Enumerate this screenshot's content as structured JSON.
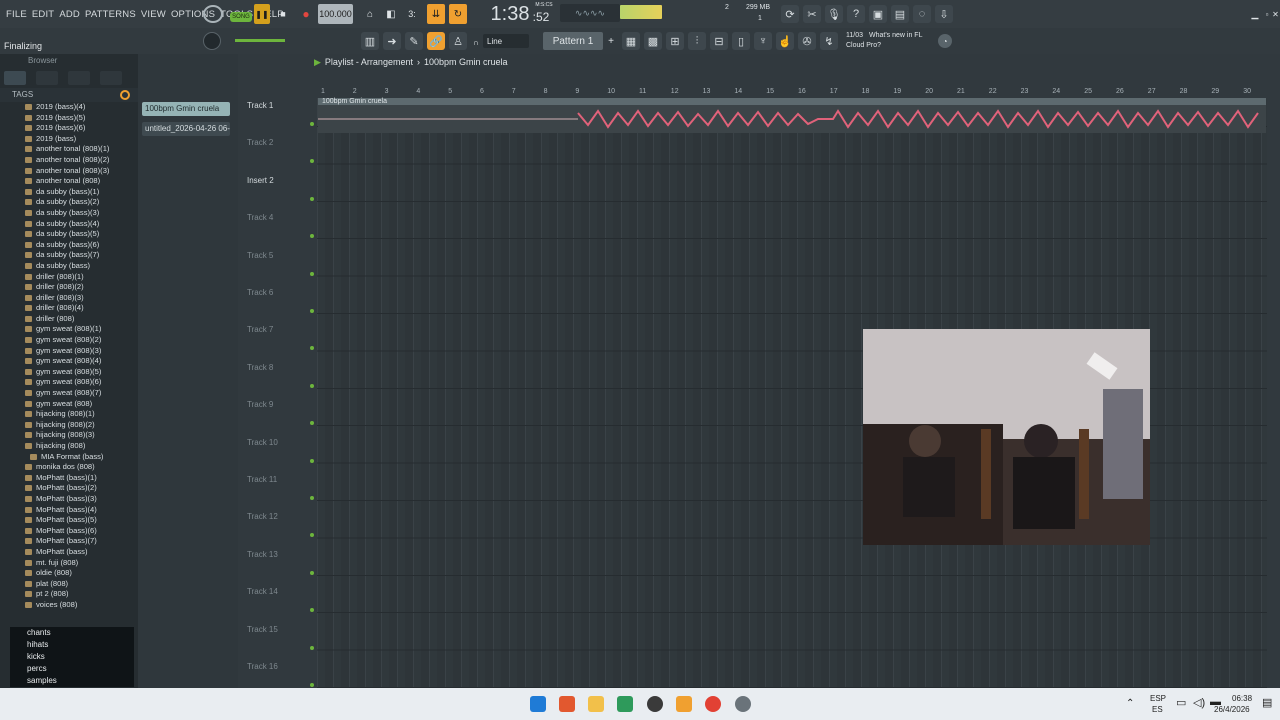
{
  "menu": {
    "file": "FILE",
    "edit": "EDIT",
    "add": "ADD",
    "patterns": "PATTERNS",
    "view": "VIEW",
    "options": "OPTIONS",
    "tools": "TOOLS",
    "help": "HELP"
  },
  "transport": {
    "song_label": "SONG",
    "tempo": "100.000",
    "time": "1:38",
    "time_frac": ":52",
    "time_unit": "M:S:CS",
    "memory": "299 MB",
    "cpu_num": "2",
    "voices_num": "1",
    "pattern": "Pattern 1",
    "snap": "Line"
  },
  "news": {
    "date": "11/03",
    "text1": "What's new in FL",
    "text2": "Cloud Pro?"
  },
  "status": "Finalizing",
  "browser": {
    "header": "Browser",
    "tags_label": "TAGS",
    "folders": [
      "2019 (bass)(4)",
      "2019 (bass)(5)",
      "2019 (bass)(6)",
      "2019 (bass)",
      "another tonal (808)(1)",
      "another tonal (808)(2)",
      "another tonal (808)(3)",
      "another tonal (808)",
      "da subby (bass)(1)",
      "da subby (bass)(2)",
      "da subby (bass)(3)",
      "da subby (bass)(4)",
      "da subby (bass)(5)",
      "da subby (bass)(6)",
      "da subby (bass)(7)",
      "da subby (bass)",
      "driller (808)(1)",
      "driller (808)(2)",
      "driller (808)(3)",
      "driller (808)(4)",
      "driller (808)",
      "gym sweat (808)(1)",
      "gym sweat (808)(2)",
      "gym sweat (808)(3)",
      "gym sweat (808)(4)",
      "gym sweat (808)(5)",
      "gym sweat (808)(6)",
      "gym sweat (808)(7)",
      "gym sweat (808)",
      "hijacking (808)(1)",
      "hijacking (808)(2)",
      "hijacking (808)(3)",
      "hijacking (808)",
      "MIA Format (bass)",
      "monika dos (808)",
      "MoPhatt (bass)(1)",
      "MoPhatt (bass)(2)",
      "MoPhatt (bass)(3)",
      "MoPhatt (bass)(4)",
      "MoPhatt (bass)(5)",
      "MoPhatt (bass)(6)",
      "MoPhatt (bass)(7)",
      "MoPhatt (bass)",
      "mt. fuji (808)",
      "oldie (808)",
      "plat (808)",
      "pt 2 (808)",
      "voices (808)"
    ],
    "categories": [
      "chants",
      "hihats",
      "kicks",
      "percs",
      "samples"
    ]
  },
  "picker": {
    "clip1": "100bpm Gmin cruela",
    "clip2": "untitled_2026-04-26 06-"
  },
  "playlist": {
    "title": "Playlist - Arrangement",
    "crumb": "100bpm Gmin cruela",
    "clip_label": "100bpm Gmin cruela",
    "tracks": [
      "Track 1",
      "Track 2",
      "Insert 2",
      "Track 4",
      "Track 5",
      "Track 6",
      "Track 7",
      "Track 8",
      "Track 9",
      "Track 10",
      "Track 11",
      "Track 12",
      "Track 13",
      "Track 14",
      "Track 15",
      "Track 16"
    ],
    "bars": [
      "1",
      "2",
      "3",
      "4",
      "5",
      "6",
      "7",
      "8",
      "9",
      "10",
      "11",
      "12",
      "13",
      "14",
      "15",
      "16",
      "17",
      "18",
      "19",
      "20",
      "21",
      "22",
      "23",
      "24",
      "25",
      "26",
      "27",
      "28",
      "29",
      "30"
    ]
  },
  "taskbar": {
    "lang1": "ESP",
    "lang2": "ES",
    "clock": "06:38",
    "date": "26/4/2026"
  },
  "colors": {
    "accent": "#f0a030",
    "green": "#6db53d",
    "wave": "#e0627a",
    "clip_bg": "#3c4448"
  }
}
